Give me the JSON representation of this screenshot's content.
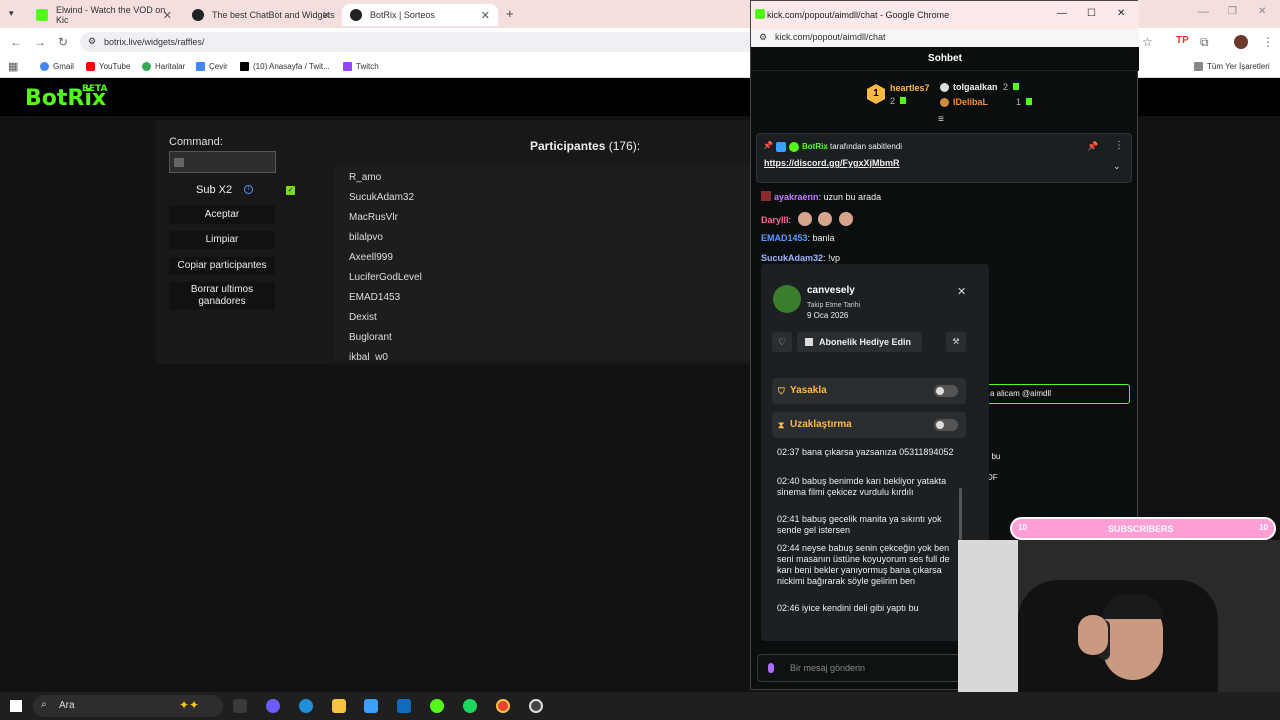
{
  "browser": {
    "tabs": [
      {
        "title": "Elwind - Watch the VOD on Kic"
      },
      {
        "title": "The best ChatBot and Widgets"
      },
      {
        "title": "BotRix | Sorteos"
      }
    ],
    "url": "botrix.live/widgets/raffles/",
    "bookmarks": [
      "Gmail",
      "YouTube",
      "Haritalar",
      "Çevir",
      "(10) Anasayfa / Twit...",
      "Twitch"
    ],
    "all_bookmarks": "Tüm Yer İşaretleri"
  },
  "botrix": {
    "logo": "BotRix",
    "logo_badge": "BETA",
    "command_label": "Command:",
    "sub_label": "Sub X2",
    "buttons": {
      "accept": "Aceptar",
      "clear": "Limpiar",
      "copy": "Copiar participantes",
      "delete": "Borrar ultimos ganadores"
    },
    "participants_title": "Participantes",
    "participants_count": "(176):",
    "participants": [
      "R_amo",
      "SucukAdam32",
      "MacRusVlr",
      "bilalpvo",
      "Axeell999",
      "LuciferGodLevel",
      "EMAD1453",
      "Dexist",
      "Buglorant",
      "ikbal_w0"
    ]
  },
  "popup": {
    "window_title": "kick.com/popout/aimdll/chat - Google Chrome",
    "url": "kick.com/popout/aimdll/chat",
    "chat_title": "Sohbet",
    "leaderboard": [
      {
        "name": "heartles7",
        "count": "2",
        "rank": "1"
      },
      {
        "name": "tolgaalkan",
        "count": "2"
      },
      {
        "name": "IDelibaL",
        "count": "1"
      }
    ],
    "pinned": {
      "by": "BotRix",
      "by_suffix": "tarafından sabitlendi",
      "link": "https://discord.gg/FygxXjMbmR"
    },
    "messages": [
      {
        "user": "ayakraenn",
        "text": ": uzun bu arada",
        "color": "#c67bff"
      },
      {
        "user": "Darylll",
        "text": ":",
        "color": "#ff6b9d"
      },
      {
        "user": "EMAD1453",
        "text": ": banla",
        "color": "#5b9dff"
      },
      {
        "user": "SucukAdam32",
        "text": ": !vp",
        "color": "#9ab4ff"
      }
    ],
    "partial_right": [
      "a alicam @aimdll",
      "ı bu",
      "DF"
    ],
    "input_placeholder": "Bir mesaj gönderin"
  },
  "usercard": {
    "username": "canvesely",
    "follow_label": "Takip Etme Tarihi",
    "follow_date": "9 Oca 2026",
    "gift_button": "Abonelik Hediye Edin",
    "ban_label": "Yasakla",
    "timeout_label": "Uzaklaştırma",
    "messages": [
      "02:37 bana çıkarsa yazsanıza 05311894052",
      "02:40 babuş benimde karı bekliyor yatakta sinema filmi çekicez vurdulu kırdılı",
      "02:41 babuş gecelik manita ya sıkıntı yok sende gel istersen",
      "02:44 neyse babuş senin çekceğin yok ben seni masanın üstüne koyuyorum ses full de karı beni bekler yanıyormuş bana çıkarsa nickimi bağırarak söyle gelirim ben",
      "02:46 iyice kendini deli gibi yaptı bu"
    ]
  },
  "overlay": {
    "sub_label": "SUBSCRIBERS",
    "sub_left": "10",
    "sub_right": "10"
  },
  "taskbar": {
    "search_placeholder": "Ara"
  },
  "colors": {
    "kick_green": "#53fc18",
    "warning_orange": "#fdba43",
    "subscribers_pink": "#ff9fd6"
  }
}
